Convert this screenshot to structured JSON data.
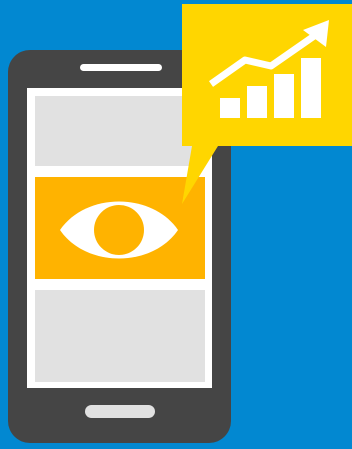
{
  "colors": {
    "background": "#0288d1",
    "phone_body": "#454545",
    "speaker": "#ffffff",
    "screen_frame": "#ffffff",
    "panel": "#e1e1e1",
    "panel_highlight": "#ffb300",
    "eye": "#ffffff",
    "pupil": "#ffb300",
    "home_button": "#e1e1e1",
    "speech_bubble": "#ffd600",
    "chart_icon": "#ffffff"
  },
  "icons": {
    "eye": "eye-icon",
    "growth_chart": "growth-chart-icon",
    "arrow": "trend-arrow-icon"
  }
}
